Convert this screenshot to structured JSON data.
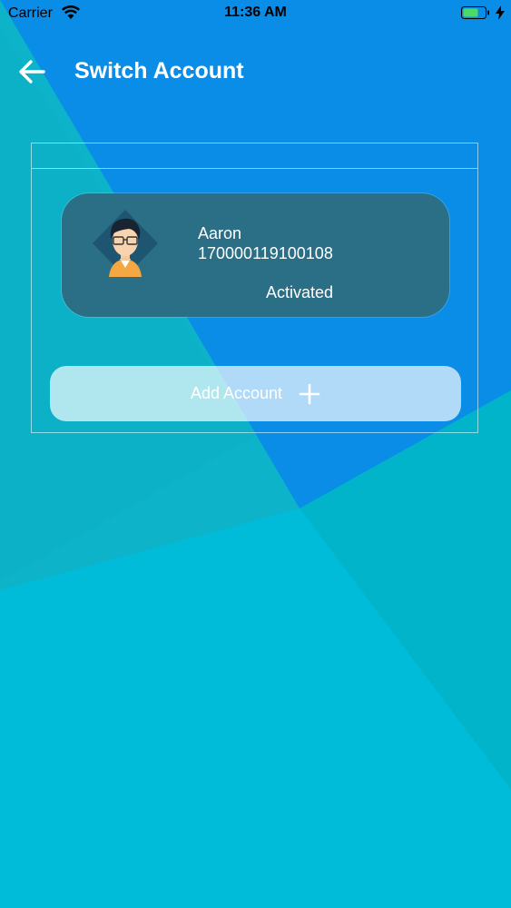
{
  "status_bar": {
    "carrier": "Carrier",
    "time": "11:36 AM",
    "battery_color": "#4cd964"
  },
  "nav": {
    "title": "Switch Account",
    "back_icon": "arrow-left-icon"
  },
  "colors": {
    "card": "#2b6f86",
    "bg_blue": "#0a8de6",
    "bg_cyan": "#00bcd8",
    "bg_teal": "#0cb2c6"
  },
  "accounts": [
    {
      "name": "Aaron",
      "number": "170000119100108",
      "status": "Activated"
    }
  ],
  "actions": {
    "add_account_label": "Add Account",
    "add_icon": "plus-icon"
  }
}
